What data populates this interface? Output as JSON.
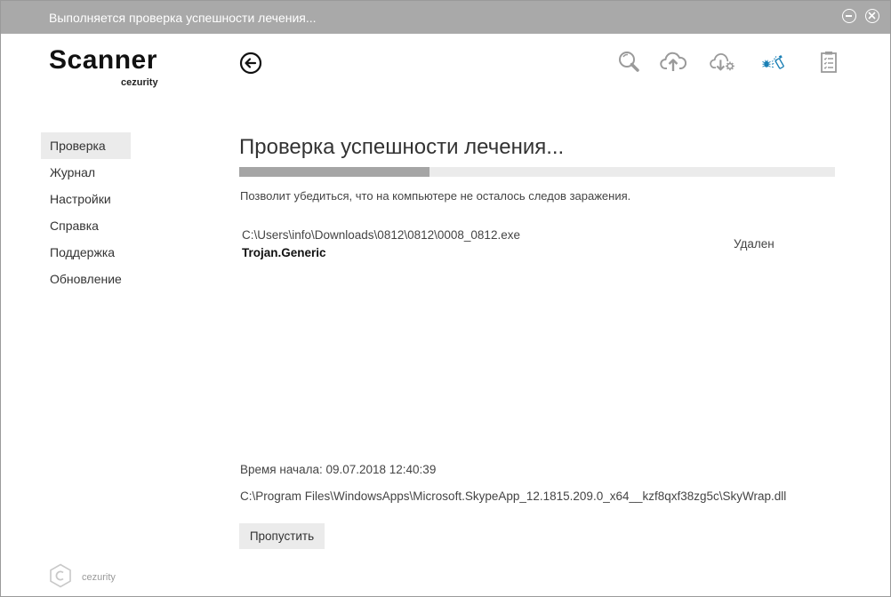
{
  "window": {
    "title": "Выполняется проверка успешности лечения..."
  },
  "app": {
    "logo_title": "Scanner",
    "logo_sub": "cezurity",
    "footer_brand": "cezurity"
  },
  "toolbar": {
    "icons": [
      "search-icon",
      "cloud-upload-icon",
      "cloud-download-settings-icon",
      "bug-spray-icon",
      "clipboard-list-icon"
    ],
    "accent_color": "#1a7fb5",
    "icon_color": "#9a9a9a"
  },
  "sidebar": {
    "items": [
      {
        "label": "Проверка",
        "active": true
      },
      {
        "label": "Журнал"
      },
      {
        "label": "Настройки"
      },
      {
        "label": "Справка"
      },
      {
        "label": "Поддержка"
      },
      {
        "label": "Обновление"
      }
    ]
  },
  "main": {
    "heading": "Проверка успешности лечения...",
    "progress": 0.32,
    "description": "Позволит убедиться, что на компьютере не осталось следов заражения.",
    "threats": [
      {
        "path": "C:\\Users\\info\\Downloads\\0812\\0812\\0008_0812.exe",
        "name": "Trojan.Generic",
        "status": "Удален"
      }
    ],
    "start_time": "Время начала: 09.07.2018 12:40:39",
    "current_file": "C:\\Program Files\\WindowsApps\\Microsoft.SkypeApp_12.1815.209.0_x64__kzf8qxf38zg5c\\SkyWrap.dll",
    "skip_label": "Пропустить"
  }
}
